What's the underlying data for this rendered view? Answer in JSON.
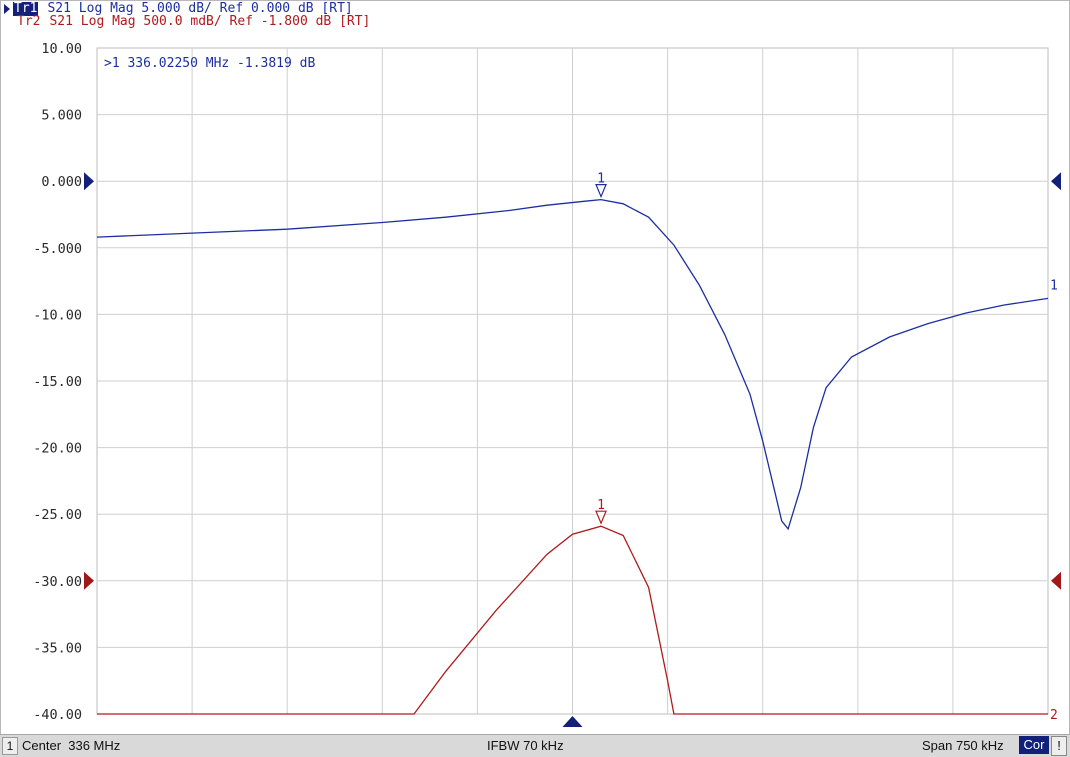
{
  "header": {
    "tr1_label": "Tr1",
    "tr1_text": "S21 Log Mag 5.000 dB/ Ref 0.000 dB [RT]",
    "tr2_label": "Tr2",
    "tr2_text": "S21 Log Mag 500.0 mdB/ Ref -1.800 dB [RT]"
  },
  "marker_readout": ">1  336.02250 MHz -1.3819 dB",
  "status": {
    "channel": "1",
    "center": "Center  336 MHz",
    "ifbw": "IFBW 70 kHz",
    "span": "Span 750 kHz",
    "cor": "Cor",
    "warning": "!"
  },
  "colors": {
    "trace1": "#1c2fa0",
    "trace2": "#b01a1a",
    "grid": "#cfcfcf",
    "background": "#ffffff"
  },
  "chart_data": {
    "type": "line",
    "title": "",
    "xlabel": "",
    "ylabel": "",
    "x_units": "MHz",
    "xlim": [
      335.625,
      336.375
    ],
    "ylim": [
      -40,
      10
    ],
    "yticks": [
      "10.00",
      "5.000",
      "0.000",
      "-5.000",
      "-10.00",
      "-15.00",
      "-20.00",
      "-25.00",
      "-30.00",
      "-35.00",
      "-40.00"
    ],
    "grid": true,
    "series": [
      {
        "name": "Tr1",
        "x": [
          335.625,
          335.7,
          335.775,
          335.85,
          335.9,
          335.95,
          335.98,
          336.01,
          336.0225,
          336.04,
          336.06,
          336.08,
          336.1,
          336.12,
          336.14,
          336.15,
          336.16,
          336.165,
          336.17,
          336.18,
          336.19,
          336.2,
          336.22,
          336.25,
          336.28,
          336.31,
          336.34,
          336.375
        ],
        "y": [
          -4.2,
          -3.9,
          -3.6,
          -3.1,
          -2.7,
          -2.2,
          -1.8,
          -1.5,
          -1.3819,
          -1.7,
          -2.7,
          -4.8,
          -7.8,
          -11.5,
          -16.0,
          -19.5,
          -23.5,
          -25.5,
          -26.1,
          -23.0,
          -18.5,
          -15.5,
          -13.2,
          -11.7,
          -10.7,
          -9.9,
          -9.3,
          -8.8
        ],
        "end_label": "1",
        "ref_level": 0.0,
        "scale_per_div": 5.0
      },
      {
        "name": "Tr2",
        "x": [
          335.625,
          335.875,
          335.9,
          335.94,
          335.98,
          336.0,
          336.0225,
          336.04,
          336.06,
          336.075,
          336.08,
          336.1,
          336.2,
          336.375
        ],
        "y": [
          -40.0,
          -40.0,
          -36.8,
          -32.2,
          -28.0,
          -26.5,
          -25.9,
          -26.6,
          -30.5,
          -37.5,
          -40.0,
          -40.0,
          -40.0,
          -40.0
        ],
        "end_label": "2",
        "ref_level": -1.8,
        "scale_per_div": 0.5
      }
    ],
    "markers": [
      {
        "label": "1",
        "x": 336.0225,
        "trace": "Tr1"
      },
      {
        "label": "1",
        "x": 336.0225,
        "trace": "Tr2"
      }
    ],
    "reference_markers": [
      {
        "trace": "Tr1",
        "y": 0.0
      },
      {
        "trace": "Tr2",
        "y": -30.0
      }
    ],
    "stimulus_marker_x": 336.0
  }
}
